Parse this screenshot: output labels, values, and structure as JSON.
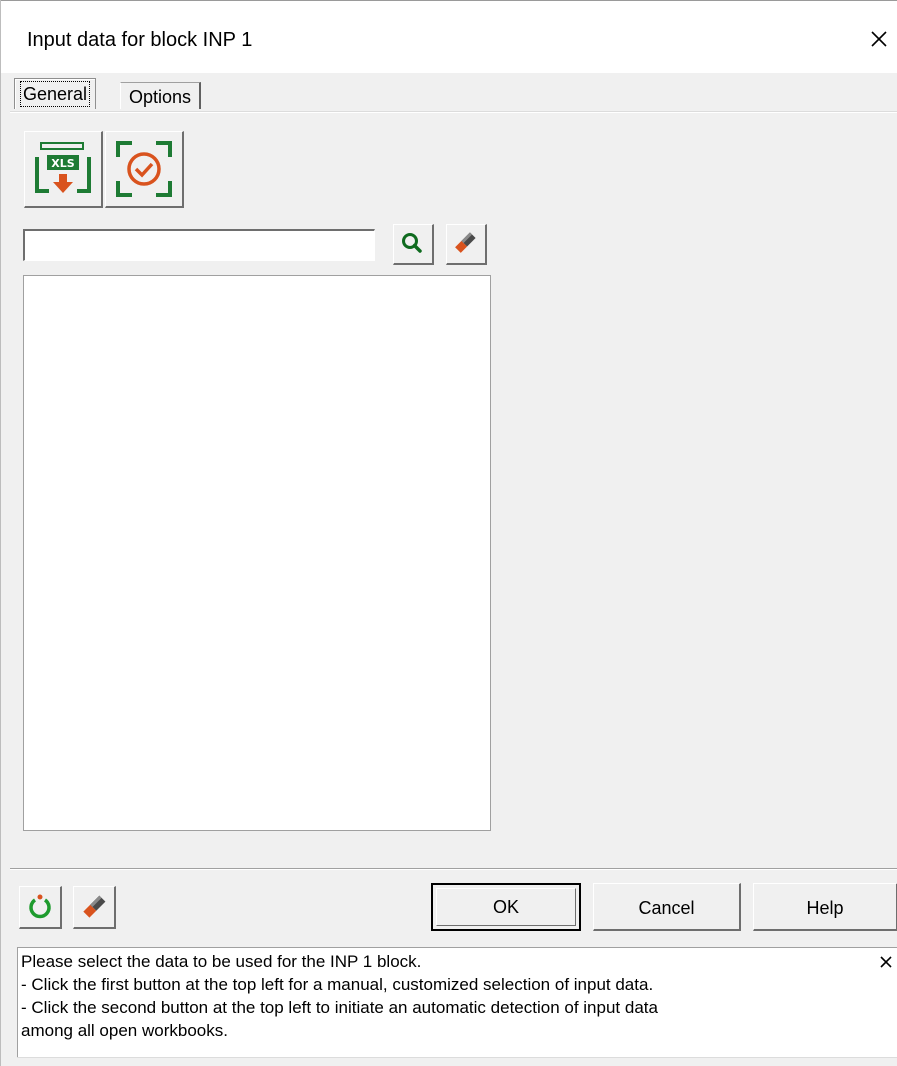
{
  "window": {
    "title": "Input data for block INP 1"
  },
  "tabs": [
    {
      "label": "General",
      "active": true
    },
    {
      "label": "Options",
      "active": false
    }
  ],
  "toolbar": {
    "xls_button_icon": "xls-import-icon",
    "xls_icon_text": "XLS",
    "auto_detect_icon": "auto-detect-icon"
  },
  "search": {
    "value": "",
    "search_icon": "search-icon",
    "erase_icon": "eraser-icon"
  },
  "data_list": {
    "items": []
  },
  "buttons": {
    "reset_icon": "reset-icon",
    "clear_icon": "eraser-icon",
    "ok": "OK",
    "cancel": "Cancel",
    "help": "Help"
  },
  "message": {
    "lines": [
      "Please select the data to be used for the INP 1 block.",
      "- Click the first button at the top left for a manual, customized selection of input data.",
      "- Click the second button at the top left to initiate an automatic detection of input data",
      "among all open workbooks."
    ]
  },
  "colors": {
    "icon_green": "#1e7b34",
    "icon_orange": "#d9531e",
    "icon_dark_green": "#0f6b1f"
  }
}
